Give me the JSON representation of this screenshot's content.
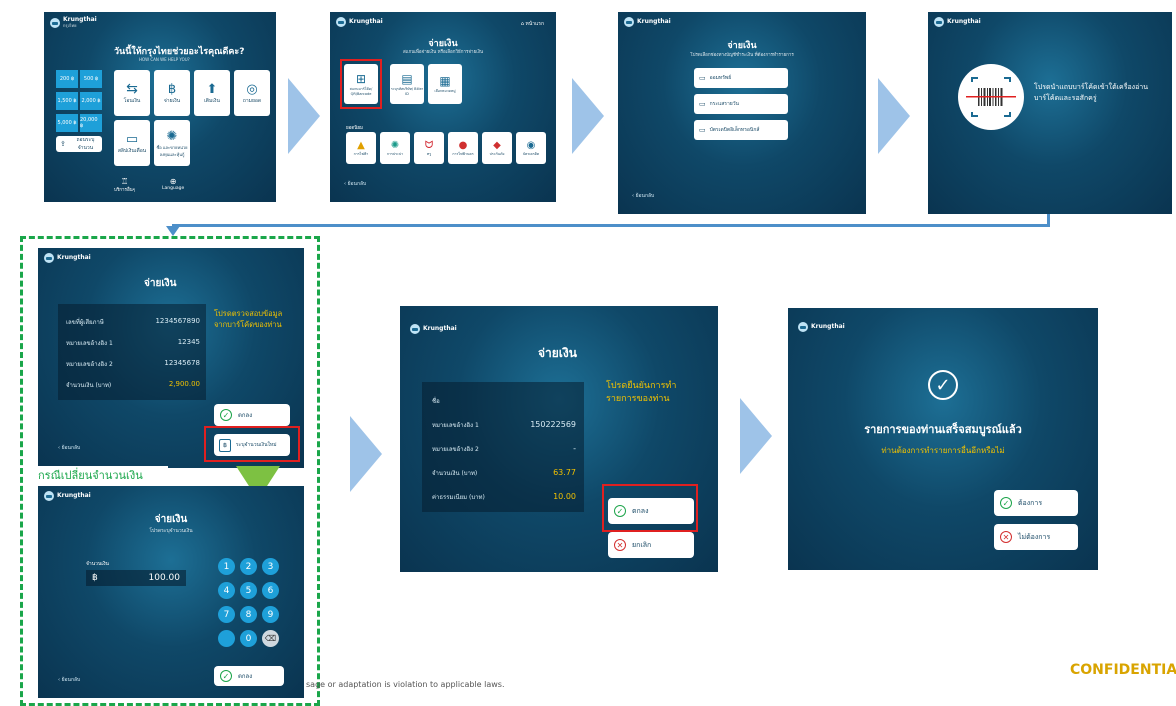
{
  "screen1": {
    "brand": "Krungthai",
    "brand_sub": "กรุงไทย",
    "title": "วันนี้ให้กรุงไทยช่วยอะไรคุณดีคะ?",
    "subtitle": "HOW CAN WE HELP YOU?",
    "amounts": [
      "200 ฿",
      "500 ฿",
      "1,500 ฿",
      "2,000 ฿",
      "5,000 ฿",
      "20,000 ฿"
    ],
    "other_amount": "ถอนระบุจำนวน",
    "menu": [
      "โอนเงิน",
      "จ่ายเงิน",
      "เติมเงิน",
      "ถามยอด",
      "สลิปเงินเดือน",
      "ซื้อ และขายหน่วยลงทุนและหุ้นกู้"
    ],
    "footer": [
      "บริการอื่นๆ",
      "Language"
    ]
  },
  "screen2": {
    "title": "จ่ายเงิน",
    "subtitle": "สแกนเพื่อจ่ายเงิน หรือเลือกวิธีการจ่ายเงิน",
    "home": "หน้าแรก",
    "options": [
      "สแกนบาร์โค้ด/ QR/Barcode",
      "ระบุรหัสบริษัท/ Biller ID",
      "เลือกหมวดหมู่"
    ],
    "section": "ยอดนิยม",
    "billers": [
      "การไฟฟ้า",
      "การประปา",
      "ทรู",
      "การไฟฟ้านคร",
      "ประกันภัย",
      "บัตรเครดิต"
    ],
    "back": "ย้อนกลับ"
  },
  "screen3": {
    "title": "จ่ายเงิน",
    "subtitle": "โปรดเลือกช่องทางบัญชีชำระเงิน ที่ต้องการทำรายการ",
    "options": [
      "ออมทรัพย์",
      "กระแสรายวัน",
      "บัตรเดบิตอิเล็กทรอนิกส์"
    ],
    "back": "ย้อนกลับ"
  },
  "screen4": {
    "instruction": "โปรดนำแถบบาร์โค้ดเข้าใต้เครื่องอ่านบาร์โค้ดและรอสักครู่"
  },
  "screen5": {
    "title": "จ่ายเงิน",
    "rows": [
      {
        "label": "เลขที่ผู้เสียภาษี",
        "value": "1234567890"
      },
      {
        "label": "หมายเลขอ้างอิง 1",
        "value": "12345"
      },
      {
        "label": "หมายเลขอ้างอิง 2",
        "value": "12345678"
      },
      {
        "label": "จำนวนเงิน (บาท)",
        "value": "2,900.00"
      }
    ],
    "notice": "โปรดตรวจสอบข้อมูล จากบาร์โค้ดของท่าน",
    "ok": "ตกลง",
    "specify": "ระบุจำนวนเงินใหม่",
    "back": "ย้อนกลับ"
  },
  "change_label": "กรณีเปลี่ยนจำนวนเงิน",
  "screen6": {
    "title": "จ่ายเงิน",
    "subtitle": "โปรดระบุจำนวนเงิน",
    "amount_label": "จำนวนเงิน",
    "currency": "฿",
    "amount": "100.00",
    "keys": [
      "1",
      "2",
      "3",
      "4",
      "5",
      "6",
      "7",
      "8",
      "9",
      "0"
    ],
    "ok": "ตกลง",
    "back": "ย้อนกลับ"
  },
  "screen7": {
    "title": "จ่ายเงิน",
    "rows": [
      {
        "label": "ชื่อ",
        "value": ""
      },
      {
        "label": "หมายเลขอ้างอิง 1",
        "value": "150222569"
      },
      {
        "label": "หมายเลขอ้างอิง 2",
        "value": "-"
      },
      {
        "label": "จำนวนเงิน (บาท)",
        "value": "63.77"
      },
      {
        "label": "ค่าธรรมเนียม (บาท)",
        "value": "10.00"
      }
    ],
    "notice": "โปรดยืนยันการทำ รายการของท่าน",
    "ok": "ตกลง",
    "cancel": "ยกเลิก"
  },
  "screen8": {
    "title": "รายการของท่านเสร็จสมบูรณ์แล้ว",
    "subtitle": "ท่านต้องการทำรายการอื่นอีกหรือไม่",
    "yes": "ต้องการ",
    "no": "ไม่ต้องการ"
  },
  "footer_text": "sage or adaptation is violation to applicable laws.",
  "confidential": "CONFIDENTIA",
  "colors": {
    "accent": "#1ea0d9",
    "highlight": "#e02020",
    "dashed": "#1aa64a",
    "arrow": "#9ec3e8",
    "yellow": "#f2c200"
  }
}
